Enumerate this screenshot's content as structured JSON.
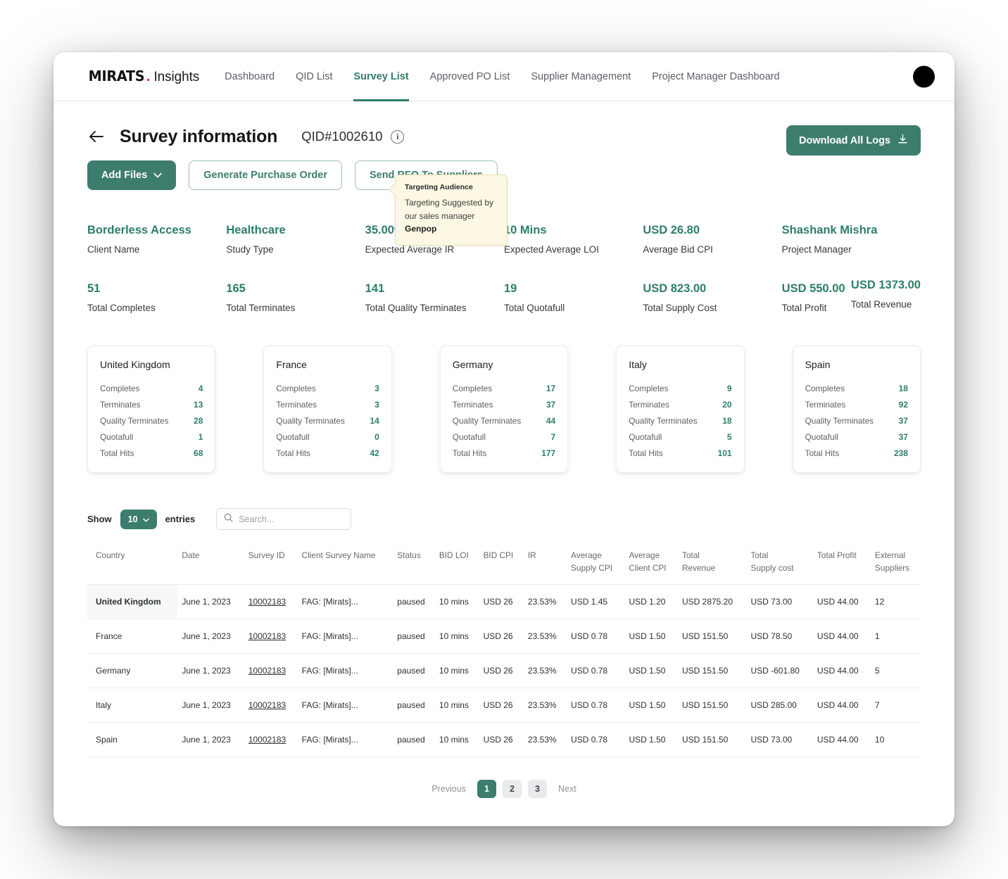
{
  "brand": {
    "name_bold": "MIRATS",
    "dot": ".",
    "name_light": "Insights"
  },
  "nav": {
    "items": [
      {
        "label": "Dashboard",
        "active": false
      },
      {
        "label": "QID List",
        "active": false
      },
      {
        "label": "Survey List",
        "active": true
      },
      {
        "label": "Approved PO List",
        "active": false
      },
      {
        "label": "Supplier Management",
        "active": false
      },
      {
        "label": "Project Manager Dashboard",
        "active": false
      }
    ]
  },
  "header": {
    "title": "Survey information",
    "qid": "QID#1002610",
    "info_icon": "info-icon",
    "download_label": "Download All Logs",
    "download_icon": "download-icon"
  },
  "tooltip": {
    "title": "Targeting Audience",
    "body_pre": "Targeting Suggested by our sales manager ",
    "body_bold": "Genpop"
  },
  "actions": [
    {
      "label": "Add Files",
      "style": "primary",
      "icon": "chevron-down-icon"
    },
    {
      "label": "Generate Purchase Order",
      "style": "outline"
    },
    {
      "label": "Send RFQ To Suppliers",
      "style": "outline"
    }
  ],
  "stats": [
    {
      "value": "Borderless Access",
      "label": "Client Name"
    },
    {
      "value": "Healthcare",
      "label": "Study Type"
    },
    {
      "value": "35.00%",
      "label": "Expected Average IR"
    },
    {
      "value": "10 Mins",
      "label": "Expected Average LOI"
    },
    {
      "value": "USD 26.80",
      "label": "Average Bid CPI"
    },
    {
      "value": "Shashank Mishra",
      "label": "Project Manager"
    },
    {
      "value": "USD 1373.00",
      "label": "Total Revenue"
    },
    {
      "value": "51",
      "label": "Total Completes"
    },
    {
      "value": "165",
      "label": "Total Terminates"
    },
    {
      "value": "141",
      "label": "Total Quality Terminates"
    },
    {
      "value": "19",
      "label": "Total Quotafull"
    },
    {
      "value": "USD 823.00",
      "label": "Total Supply Cost"
    },
    {
      "value": "USD 550.00",
      "label": "Total Profit"
    }
  ],
  "country_cards": {
    "row_labels": [
      "Completes",
      "Terminates",
      "Quality Terminates",
      "Quotafull",
      "Total Hits"
    ],
    "cards": [
      {
        "title": "United Kingdom",
        "values": [
          "4",
          "13",
          "28",
          "1",
          "68"
        ]
      },
      {
        "title": "France",
        "values": [
          "3",
          "3",
          "14",
          "0",
          "42"
        ]
      },
      {
        "title": "Germany",
        "values": [
          "17",
          "37",
          "44",
          "7",
          "177"
        ]
      },
      {
        "title": "Italy",
        "values": [
          "9",
          "20",
          "18",
          "5",
          "101"
        ]
      },
      {
        "title": "Spain",
        "values": [
          "18",
          "92",
          "37",
          "37",
          "238"
        ]
      }
    ]
  },
  "table_controls": {
    "show_label": "Show",
    "page_size": "10",
    "page_size_icon": "caret-down-icon",
    "entries_label": "entries",
    "search_icon": "search-icon",
    "search_placeholder": "Search...",
    "search_value": ""
  },
  "table": {
    "columns": [
      "Country",
      "Date",
      "Survey ID",
      "Client Survey Name",
      "Status",
      "BID LOI",
      "BID CPI",
      "IR",
      "Average\nSupply CPI",
      "Average\nClient CPI",
      "Total\nRevenue",
      "Total\nSupply cost",
      "Total Profit",
      "External\nSuppliers"
    ],
    "rows": [
      {
        "country": "United Kingdom",
        "date": "June 1, 2023",
        "survey_id": "10002183",
        "client_survey_name": "FAG: [Mirats]...",
        "status": "paused",
        "bid_loi": "10 mins",
        "bid_cpi": "USD 26",
        "ir": "23.53%",
        "avg_supply_cpi": "USD 1.45",
        "avg_client_cpi": "USD 1.20",
        "total_revenue": "USD 2875.20",
        "total_supply_cost": "USD 73.00",
        "total_profit": "USD 44.00",
        "external_suppliers": "12"
      },
      {
        "country": "France",
        "date": "June 1, 2023",
        "survey_id": "10002183",
        "client_survey_name": "FAG: [Mirats]...",
        "status": "paused",
        "bid_loi": "10 mins",
        "bid_cpi": "USD 26",
        "ir": "23.53%",
        "avg_supply_cpi": "USD 0.78",
        "avg_client_cpi": "USD 1.50",
        "total_revenue": "USD 151.50",
        "total_supply_cost": "USD 78.50",
        "total_profit": "USD 44.00",
        "external_suppliers": "1"
      },
      {
        "country": "Germany",
        "date": "June 1, 2023",
        "survey_id": "10002183",
        "client_survey_name": "FAG: [Mirats]...",
        "status": "paused",
        "bid_loi": "10 mins",
        "bid_cpi": "USD 26",
        "ir": "23.53%",
        "avg_supply_cpi": "USD 0.78",
        "avg_client_cpi": "USD 1.50",
        "total_revenue": "USD 151.50",
        "total_supply_cost": "USD -601.80",
        "total_profit": "USD 44.00",
        "external_suppliers": "5"
      },
      {
        "country": "Italy",
        "date": "June 1, 2023",
        "survey_id": "10002183",
        "client_survey_name": "FAG: [Mirats]...",
        "status": "paused",
        "bid_loi": "10 mins",
        "bid_cpi": "USD 26",
        "ir": "23.53%",
        "avg_supply_cpi": "USD 0.78",
        "avg_client_cpi": "USD 1.50",
        "total_revenue": "USD 151.50",
        "total_supply_cost": "USD 285.00",
        "total_profit": "USD 44.00",
        "external_suppliers": "7"
      },
      {
        "country": "Spain",
        "date": "June 1, 2023",
        "survey_id": "10002183",
        "client_survey_name": "FAG: [Mirats]...",
        "status": "paused",
        "bid_loi": "10 mins",
        "bid_cpi": "USD 26",
        "ir": "23.53%",
        "avg_supply_cpi": "USD 0.78",
        "avg_client_cpi": "USD 1.50",
        "total_revenue": "USD 151.50",
        "total_supply_cost": "USD 73.00",
        "total_profit": "USD 44.00",
        "external_suppliers": "10"
      }
    ]
  },
  "pagination": {
    "previous": "Previous",
    "pages": [
      "1",
      "2",
      "3"
    ],
    "active_page": "1",
    "next": "Next"
  },
  "colors": {
    "accent_green": "#3d7d6d",
    "accent_green_text": "#2e7d6b",
    "tooltip_bg": "#fdf8e3",
    "brand_red": "#e02020"
  }
}
